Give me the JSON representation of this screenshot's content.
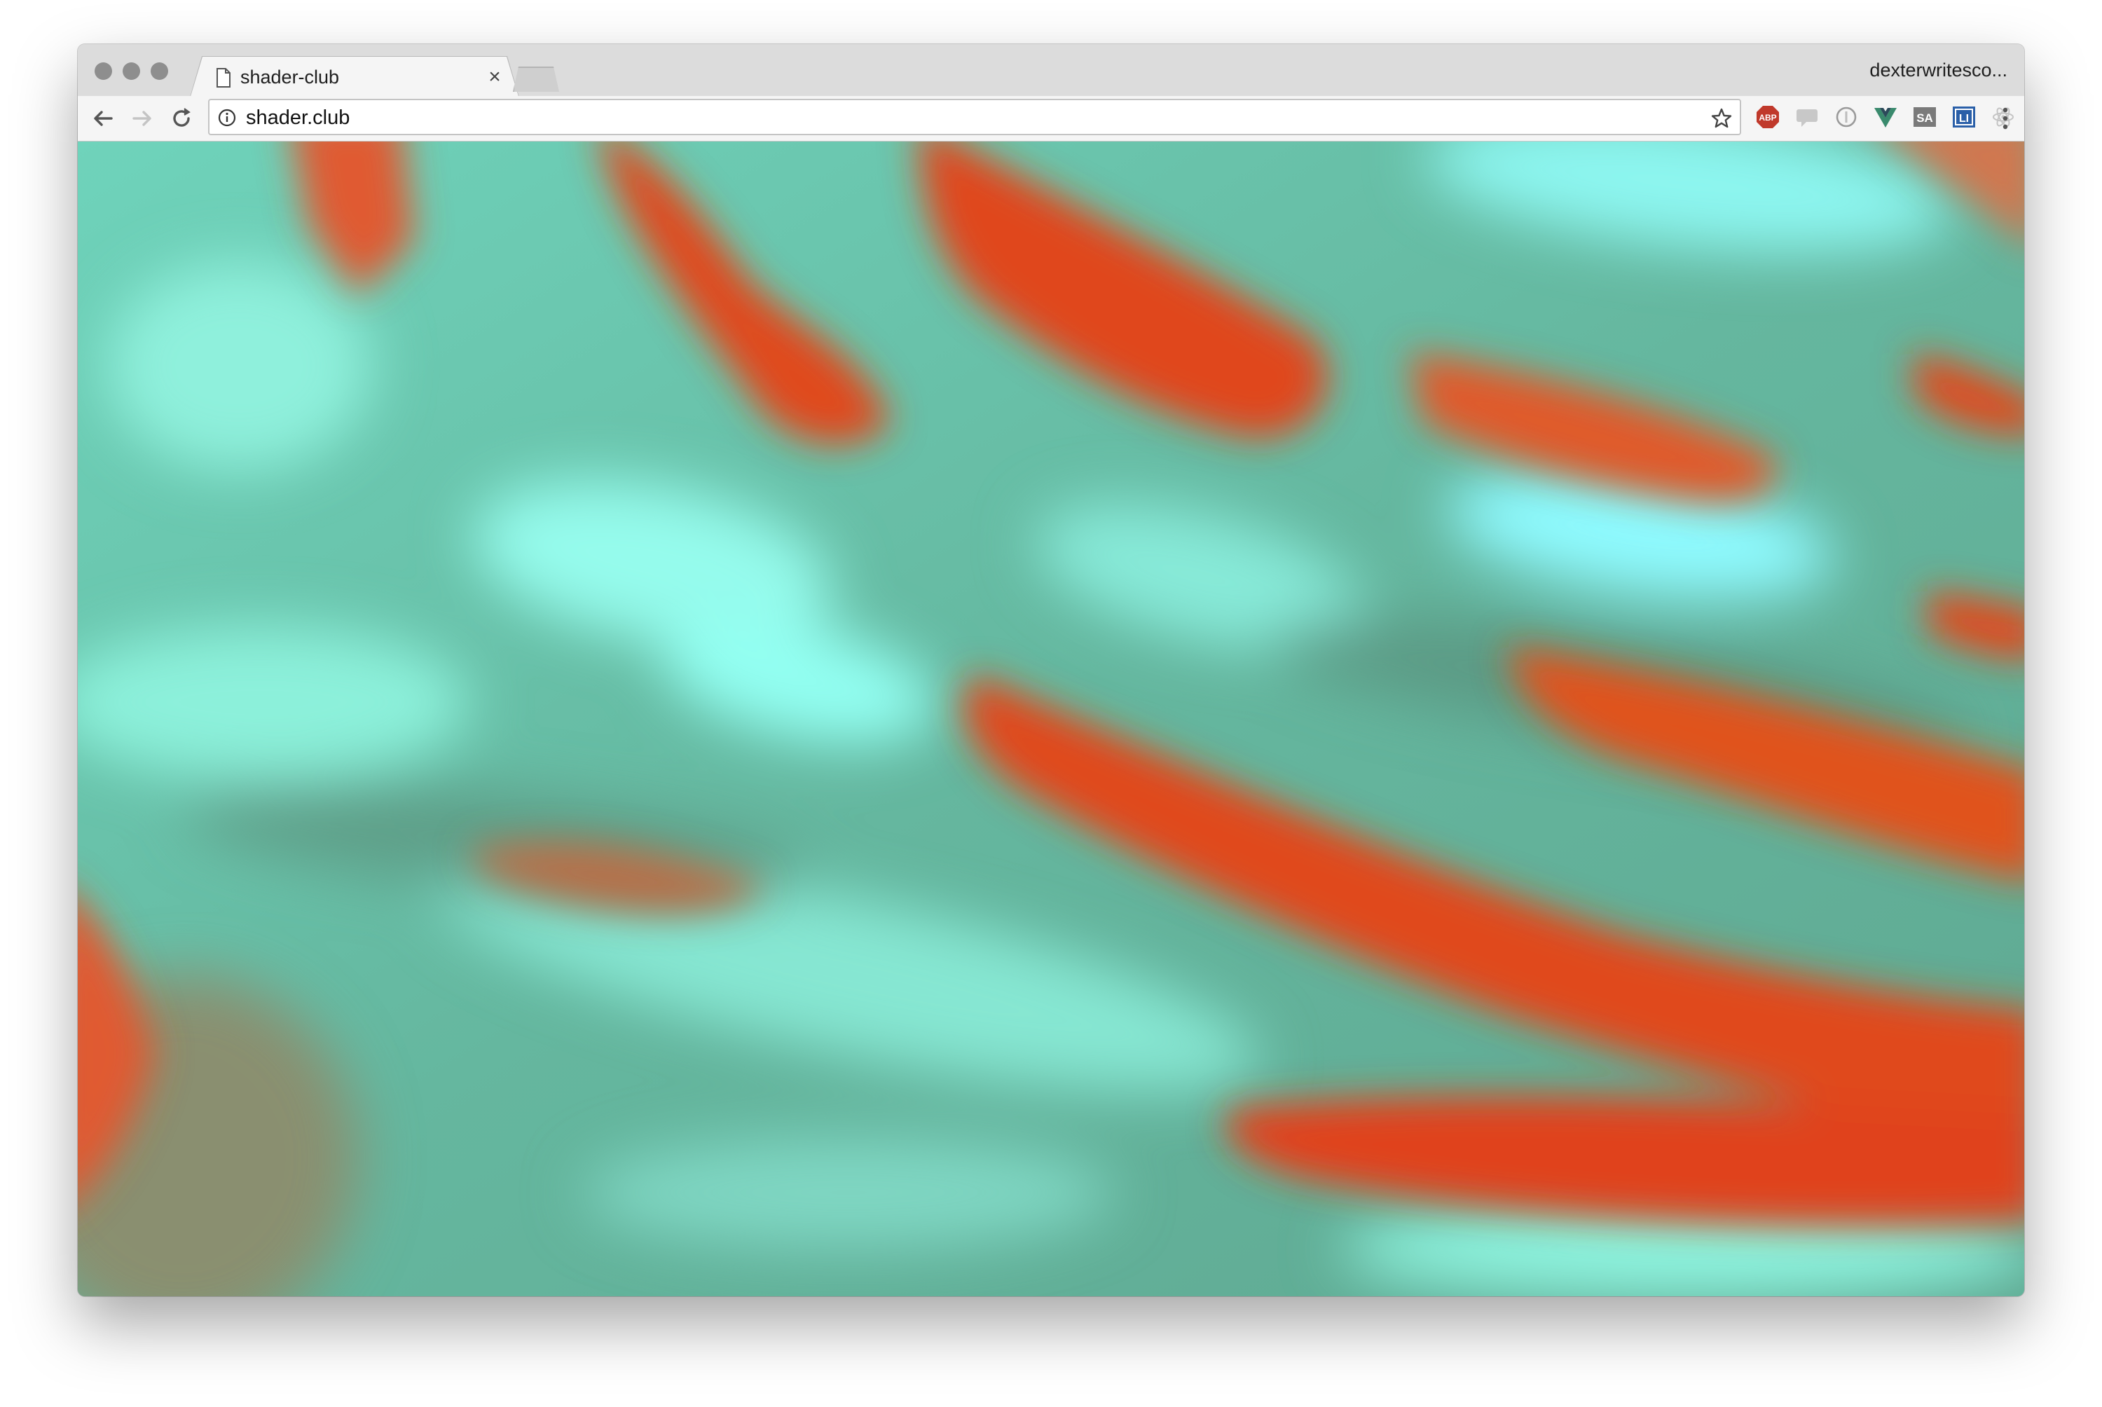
{
  "browser": {
    "tab": {
      "title": "shader-club"
    },
    "profile_name": "dexterwritesco...",
    "address_bar": {
      "url": "shader.club"
    },
    "extensions": [
      {
        "icon": "adblock-plus-icon",
        "label": "ABP",
        "color": "#c0392b"
      },
      {
        "icon": "chat-extension-icon",
        "label": "",
        "color": "#b9b9b9"
      },
      {
        "icon": "circle-extension-icon",
        "label": "",
        "color": "#9a9a9a"
      },
      {
        "icon": "vue-devtools-icon",
        "label": "V",
        "color": "#2c6e5a"
      },
      {
        "icon": "sa-extension-icon",
        "label": "SA",
        "color": "#6b6b6b"
      },
      {
        "icon": "li-extension-icon",
        "label": "LI",
        "color": "#2a5fa8"
      },
      {
        "icon": "react-devtools-icon",
        "label": "",
        "color": "#c8c8c8"
      },
      {
        "icon": "bookmark-extension-icon",
        "label": "",
        "color": "#9a9a9a"
      }
    ]
  },
  "page": {
    "canvas": {
      "description_icon": "shader-canvas",
      "colors": {
        "teal": "#6fc7ae",
        "cyan": "#8ff5ea",
        "orange": "#e0491a"
      }
    }
  }
}
